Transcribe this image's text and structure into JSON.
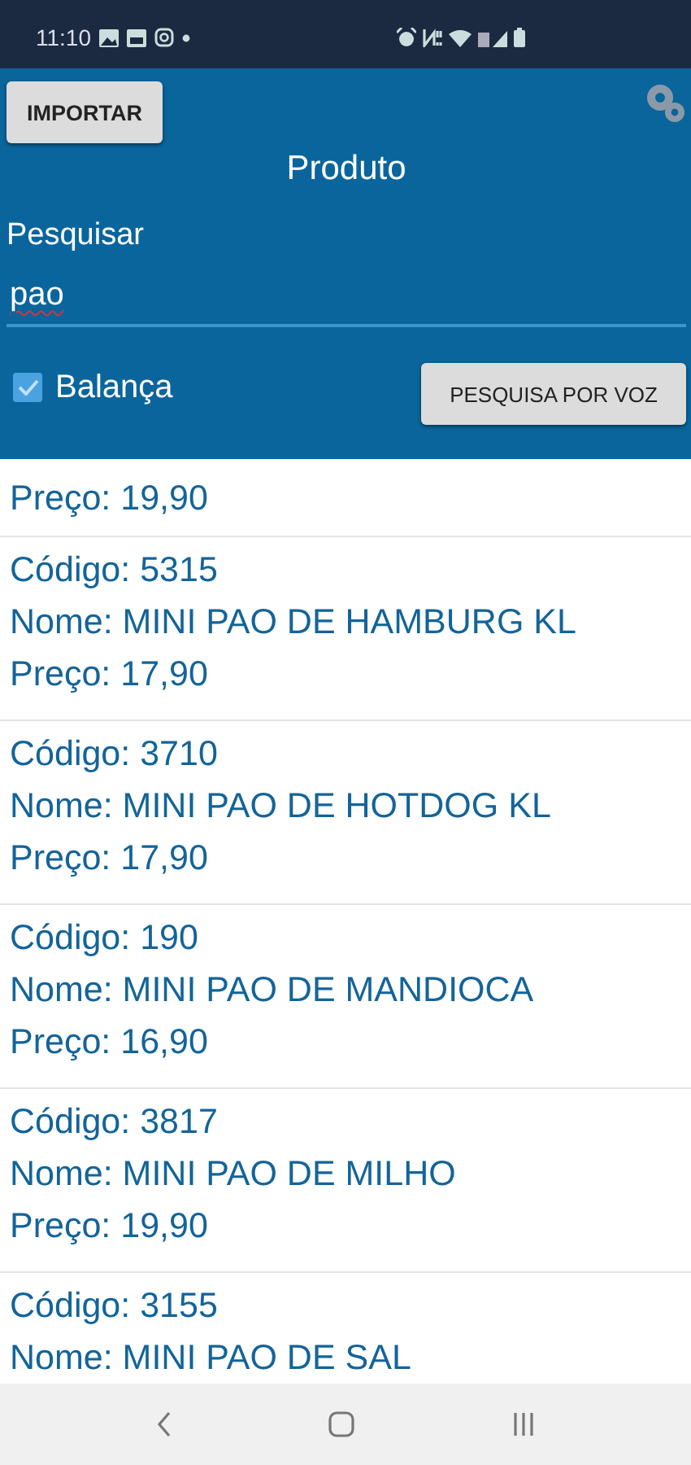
{
  "status_bar": {
    "time": "11:10"
  },
  "header": {
    "import_button": "IMPORTAR",
    "title": "Produto",
    "search_label": "Pesquisar",
    "search_value": "pao",
    "scale_checkbox": {
      "label": "Balança",
      "checked": true
    },
    "voice_button": "PESQUISA POR VOZ"
  },
  "products": [
    {
      "lines": [
        "Preço: 19,90"
      ]
    },
    {
      "lines": [
        "Código: 5315",
        "Nome: MINI PAO DE HAMBURG KL",
        "Preço: 17,90"
      ]
    },
    {
      "lines": [
        "Código: 3710",
        "Nome: MINI PAO DE HOTDOG KL",
        "Preço: 17,90"
      ]
    },
    {
      "lines": [
        "Código: 190",
        "Nome: MINI PAO DE MANDIOCA",
        "Preço: 16,90"
      ]
    },
    {
      "lines": [
        "Código: 3817",
        "Nome: MINI PAO DE MILHO",
        "Preço: 19,90"
      ]
    },
    {
      "lines": [
        "Código: 3155",
        "Nome: MINI PAO DE SAL"
      ]
    }
  ]
}
